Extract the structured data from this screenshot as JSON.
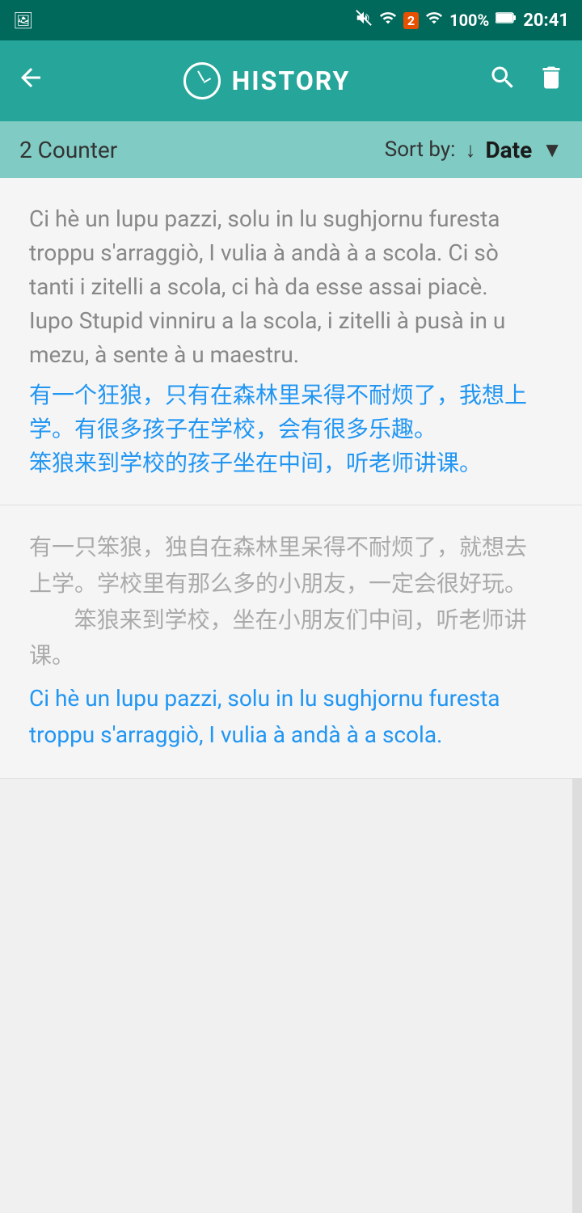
{
  "statusBar": {
    "time": "20:41",
    "battery": "100%"
  },
  "appBar": {
    "title": "HISTORY",
    "backLabel": "back",
    "searchLabel": "search",
    "deleteLabel": "delete",
    "clockLabel": "clock"
  },
  "sortBar": {
    "counter": "2 Counter",
    "sortByLabel": "Sort by:",
    "sortValue": "Date"
  },
  "cards": [
    {
      "id": 1,
      "grayText": "Ci hè un lupu pazzi, solu in lu sughjornu furesta troppu s'arraggiò, I vulia à andà à a scola. Ci sò tanti i zitelli a scola, ci hà da esse assai piacè.\nIupo Stupid vinniru a la scola, i zitelli à pusà in u mezu, à sente à u maestru.",
      "blueText": "有一个狂狼，只有在森林里呆得不耐烦了，我想上学。有很多孩子在学校，会有很多乐趣。\n笨狼来到学校的孩子坐在中间，听老师讲课。"
    },
    {
      "id": 2,
      "grayText": "有一只笨狼，独自在森林里呆得不耐烦了，就想去上学。学校里有那么多的小朋友，一定会很好玩。\n\t笨狼来到学校，坐在小朋友们中间，听老师讲课。",
      "blueText": "Ci hè un lupu pazzi, solu in lu sughjornu furesta troppu s'arraggiò, I vulia à andà à a scola."
    }
  ]
}
